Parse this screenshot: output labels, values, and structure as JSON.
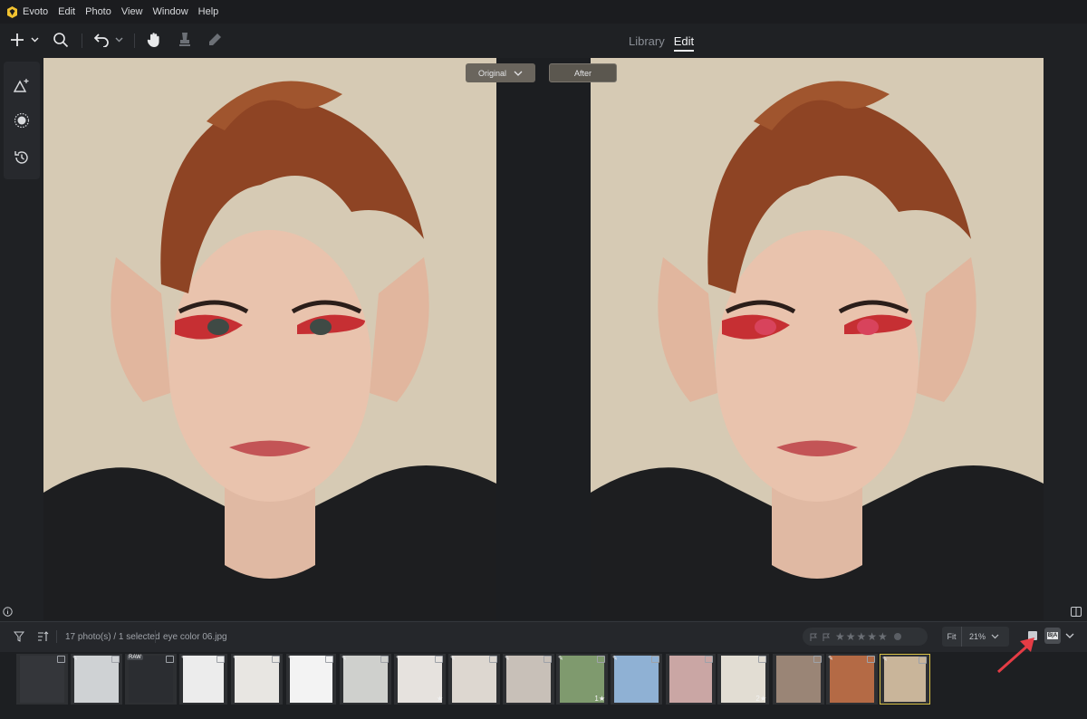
{
  "menu": {
    "app_name": "Evoto",
    "items": [
      "Edit",
      "Photo",
      "View",
      "Window",
      "Help"
    ]
  },
  "toolbar": {
    "icons": [
      "add-icon",
      "search-icon",
      "undo-icon",
      "hand-icon",
      "stamp-icon",
      "pen-icon"
    ]
  },
  "mode_tabs": [
    {
      "label": "Library",
      "active": false
    },
    {
      "label": "Edit",
      "active": true
    }
  ],
  "canvas": {
    "original_label": "Original",
    "after_label": "After"
  },
  "film_header": {
    "count_text": "17 photo(s) / 1 selected",
    "filename": "eye color 06.jpg",
    "rating_stars": "★★★★★",
    "zoom_fit": "Fit",
    "zoom_value": "21%",
    "view_mode_label": "B|A"
  },
  "thumbnails": [
    {
      "badge": "",
      "color": "#34363a",
      "star": ""
    },
    {
      "badge": "edit",
      "color": "#cfd2d4",
      "star": ""
    },
    {
      "badge": "RAW",
      "color": "#2b2d31",
      "star": ""
    },
    {
      "badge": "edit",
      "color": "#ececec",
      "star": ""
    },
    {
      "badge": "edit",
      "color": "#e8e6e2",
      "star": ""
    },
    {
      "badge": "edit",
      "color": "#f3f3f3",
      "star": ""
    },
    {
      "badge": "edit",
      "color": "#cfd0cd",
      "star": ""
    },
    {
      "badge": "edit",
      "color": "#e6e2de",
      "star": "★"
    },
    {
      "badge": "edit",
      "color": "#ddd7d0",
      "star": ""
    },
    {
      "badge": "edit",
      "color": "#c8c0b8",
      "star": ""
    },
    {
      "badge": "edit",
      "color": "#7f9a6e",
      "star": "1★"
    },
    {
      "badge": "edit",
      "color": "#8fb1d4",
      "star": ""
    },
    {
      "badge": "",
      "color": "#caa6a4",
      "star": ""
    },
    {
      "badge": "",
      "color": "#e2ddd3",
      "star": "2★"
    },
    {
      "badge": "",
      "color": "#9a8576",
      "star": ""
    },
    {
      "badge": "edit",
      "color": "#b46a45",
      "star": ""
    },
    {
      "badge": "edit",
      "color": "#c9b59a",
      "star": ""
    }
  ]
}
